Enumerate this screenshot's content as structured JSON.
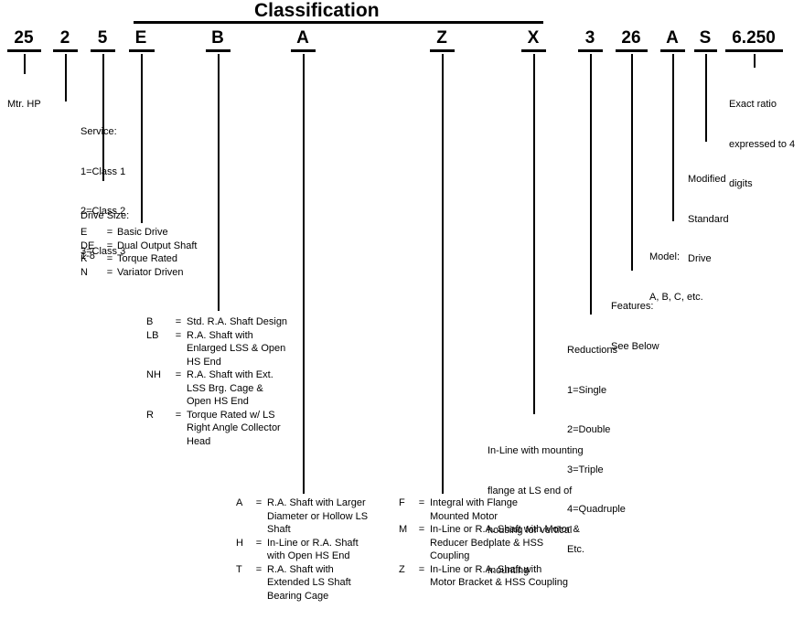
{
  "header": {
    "title": "Classification"
  },
  "code_string": {
    "segments": [
      {
        "text": "25",
        "name": "code-segment-mtr-hp"
      },
      {
        "text": "2",
        "name": "code-segment-service"
      },
      {
        "text": "5",
        "name": "code-segment-drive-size"
      },
      {
        "text": "E",
        "name": "code-segment-drive-type"
      },
      {
        "text": "B",
        "name": "code-segment-shaft-design"
      },
      {
        "text": "A",
        "name": "code-segment-shaft-arrangement"
      },
      {
        "text": "Z",
        "name": "code-segment-mounting-type"
      },
      {
        "text": "X",
        "name": "code-segment-inline-flange"
      },
      {
        "text": "3",
        "name": "code-segment-reductions"
      },
      {
        "text": "26",
        "name": "code-segment-features"
      },
      {
        "text": "A",
        "name": "code-segment-model"
      },
      {
        "text": "S",
        "name": "code-segment-modified-standard"
      },
      {
        "text": "6.250",
        "name": "code-segment-exact-ratio"
      }
    ]
  },
  "notes": {
    "mtr_hp": [
      "Mtr. HP"
    ],
    "service": [
      "Service:",
      "1=Class 1",
      "2=Class 2",
      "3=Class 3"
    ],
    "drive_size": [
      "Drive Size:",
      "1-8"
    ],
    "inline_flange": [
      "In-Line with mounting",
      "flange at LS end of",
      "housing for vertical",
      "mounting"
    ],
    "reductions": [
      "Reductions",
      "1=Single",
      "2=Double",
      "3=Triple",
      "4=Quadruple",
      "Etc."
    ],
    "features": [
      "Features:",
      "See Below"
    ],
    "model": [
      "Model:",
      "A, B, C, etc."
    ],
    "modified_standard": [
      "Modified",
      "Standard",
      "Drive"
    ],
    "exact_ratio": [
      "Exact ratio",
      "expressed to 4",
      "digits"
    ]
  },
  "definitions": {
    "drive_type": [
      {
        "code": "E",
        "eq": "=",
        "desc": [
          "Basic Drive"
        ]
      },
      {
        "code": "DE",
        "eq": "=",
        "desc": [
          "Dual Output Shaft"
        ]
      },
      {
        "code": "K",
        "eq": "=",
        "desc": [
          "Torque Rated"
        ]
      },
      {
        "code": "N",
        "eq": "=",
        "desc": [
          "Variator Driven"
        ]
      }
    ],
    "shaft_design": [
      {
        "code": "B",
        "eq": "=",
        "desc": [
          "Std. R.A. Shaft Design"
        ]
      },
      {
        "code": "LB",
        "eq": "=",
        "desc": [
          "R.A. Shaft with",
          "Enlarged LSS & Open",
          "HS End"
        ]
      },
      {
        "code": "NH",
        "eq": "=",
        "desc": [
          "R.A. Shaft with Ext.",
          "LSS Brg. Cage &",
          "Open HS End"
        ]
      },
      {
        "code": "R",
        "eq": "=",
        "desc": [
          "Torque Rated w/ LS",
          "Right Angle Collector",
          "Head"
        ]
      }
    ],
    "shaft_arrangement": [
      {
        "code": "A",
        "eq": "=",
        "desc": [
          "R.A. Shaft with Larger",
          "Diameter or Hollow LS",
          "Shaft"
        ]
      },
      {
        "code": "H",
        "eq": "=",
        "desc": [
          "In-Line or R.A. Shaft",
          "with Open HS End"
        ]
      },
      {
        "code": "T",
        "eq": "=",
        "desc": [
          "R.A. Shaft with",
          "Extended LS Shaft",
          "Bearing Cage"
        ]
      }
    ],
    "mounting_type": [
      {
        "code": "F",
        "eq": "=",
        "desc": [
          "Integral with Flange",
          "Mounted Motor"
        ]
      },
      {
        "code": "M",
        "eq": "=",
        "desc": [
          "In-Line or R.A. Shaft with Motor &",
          "Reducer Bedplate & HSS",
          "Coupling"
        ]
      },
      {
        "code": "Z",
        "eq": "=",
        "desc": [
          "In-Line or R.A. Shaft with",
          "Motor Bracket & HSS Coupling"
        ]
      }
    ]
  },
  "colors": {
    "ink": "#000000",
    "paper": "#ffffff"
  }
}
